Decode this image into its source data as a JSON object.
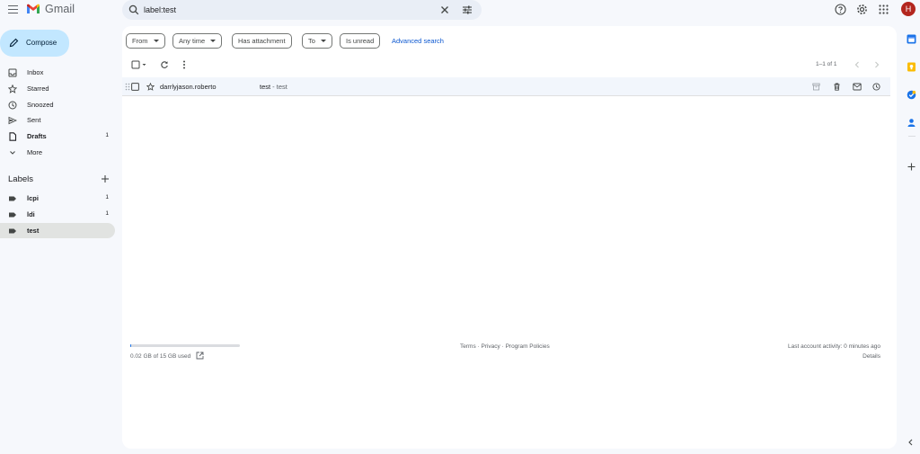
{
  "app": {
    "name": "Gmail",
    "accent": "#c2e7ff",
    "avatar_letter": "H",
    "avatar_color": "#b3261e"
  },
  "search": {
    "value": "label:test",
    "placeholder": "Search mail"
  },
  "sidebar": {
    "compose_label": "Compose",
    "items": [
      {
        "label": "Inbox",
        "icon": "inbox-icon",
        "count": ""
      },
      {
        "label": "Starred",
        "icon": "star-icon",
        "count": ""
      },
      {
        "label": "Snoozed",
        "icon": "clock-icon",
        "count": ""
      },
      {
        "label": "Sent",
        "icon": "send-icon",
        "count": ""
      },
      {
        "label": "Drafts",
        "icon": "draft-icon",
        "count": "1"
      },
      {
        "label": "More",
        "icon": "chevron-down-icon",
        "count": ""
      }
    ],
    "labels_heading": "Labels",
    "labels": [
      {
        "label": "lcpi",
        "count": "1"
      },
      {
        "label": "ldi",
        "count": "1"
      },
      {
        "label": "test",
        "count": ""
      }
    ]
  },
  "filters": {
    "from": "From",
    "any_time": "Any time",
    "has_attachment": "Has attachment",
    "to": "To",
    "is_unread": "Is unread",
    "advanced_search": "Advanced search"
  },
  "toolbar": {
    "pager": "1–1 of 1"
  },
  "messages": [
    {
      "sender": "darrlyjason.roberto",
      "subject": "test",
      "separator": " - ",
      "snippet": "test"
    }
  ],
  "footer": {
    "storage": "0.02 GB of 15 GB used",
    "storage_used_fraction": 0.0013,
    "links": [
      "Terms",
      "Privacy",
      "Program Policies"
    ],
    "link_separator": " · ",
    "last_activity": "Last account activity: 0 minutes ago",
    "details": "Details"
  }
}
